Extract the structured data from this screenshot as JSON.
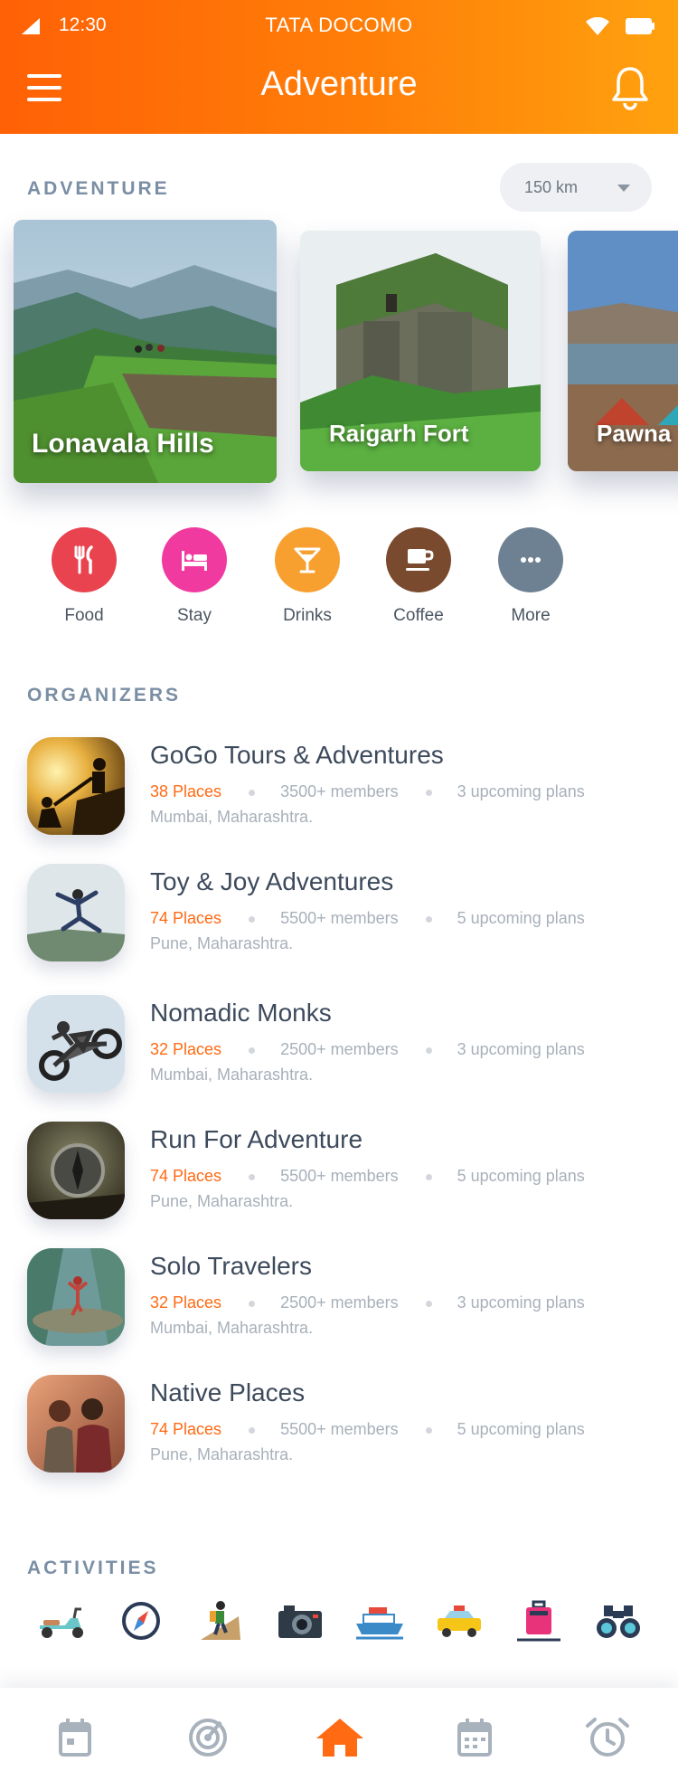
{
  "status_bar": {
    "time": "12:30",
    "carrier": "TATA DOCOMO"
  },
  "header": {
    "title": "Adventure"
  },
  "adventure": {
    "label": "ADVENTURE",
    "distance": "150 km",
    "cards": [
      {
        "title": "Lonavala Hills"
      },
      {
        "title": "Raigarh Fort"
      },
      {
        "title": "Pawna"
      }
    ]
  },
  "categories": [
    {
      "label": "Food",
      "color": "#e8434f",
      "icon": "cutlery-icon"
    },
    {
      "label": "Stay",
      "color": "#f03aa0",
      "icon": "bed-icon"
    },
    {
      "label": "Drinks",
      "color": "#f7a030",
      "icon": "cocktail-icon"
    },
    {
      "label": "Coffee",
      "color": "#7a4a2e",
      "icon": "coffee-icon"
    },
    {
      "label": "More",
      "color": "#6d8193",
      "icon": "more-icon"
    }
  ],
  "organizers": {
    "label": "ORGANIZERS",
    "items": [
      {
        "name": "GoGo Tours & Adventures",
        "places": "38 Places",
        "members": "3500+ members",
        "plans": "3 upcoming plans",
        "location": "Mumbai, Maharashtra."
      },
      {
        "name": "Toy & Joy Adventures",
        "places": "74 Places",
        "members": "5500+ members",
        "plans": "5 upcoming plans",
        "location": "Pune, Maharashtra."
      },
      {
        "name": "Nomadic Monks",
        "places": "32 Places",
        "members": "2500+ members",
        "plans": "3 upcoming plans",
        "location": "Mumbai, Maharashtra."
      },
      {
        "name": "Run For Adventure",
        "places": "74 Places",
        "members": "5500+ members",
        "plans": "5 upcoming plans",
        "location": "Pune, Maharashtra."
      },
      {
        "name": "Solo Travelers",
        "places": "32 Places",
        "members": "2500+ members",
        "plans": "3 upcoming plans",
        "location": "Mumbai, Maharashtra."
      },
      {
        "name": "Native Places",
        "places": "74 Places",
        "members": "5500+ members",
        "plans": "5 upcoming plans",
        "location": "Pune, Maharashtra."
      }
    ]
  },
  "activities": {
    "label": "ACTIVITIES",
    "icons": [
      "scooter-icon",
      "compass-icon",
      "hiker-icon",
      "camera-icon",
      "ship-icon",
      "taxi-icon",
      "luggage-icon",
      "binoculars-icon"
    ]
  },
  "bottom_nav": [
    "calendar-icon",
    "radar-icon",
    "home-icon",
    "schedule-icon",
    "alarm-icon"
  ],
  "colors": {
    "accent": "#ff6a13",
    "header_start": "#ff6106",
    "header_end": "#ffa20f",
    "label": "#7a8ea4"
  }
}
